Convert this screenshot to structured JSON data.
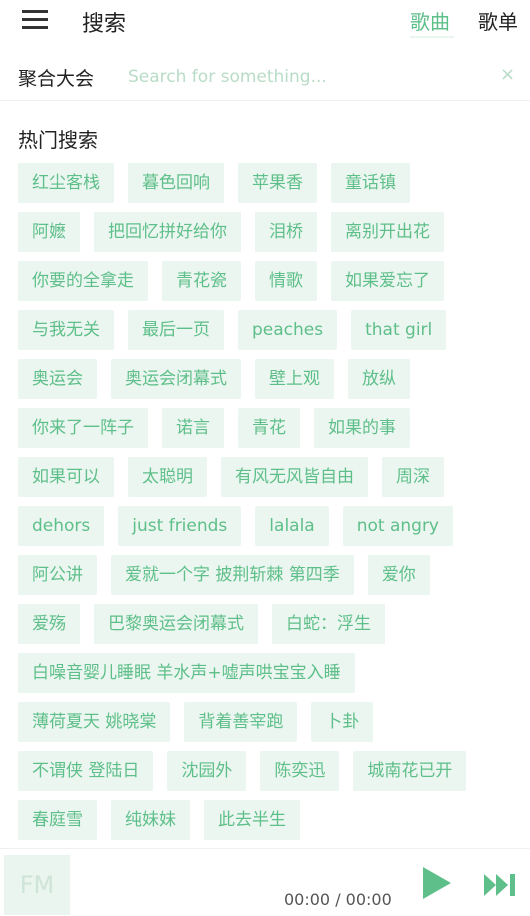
{
  "header": {
    "title": "搜索",
    "tabs": [
      "歌曲",
      "歌单"
    ]
  },
  "search": {
    "scope": "聚合大会",
    "placeholder": "Search for something...",
    "clear": "×"
  },
  "hot": {
    "title": "热门搜索",
    "rows": [
      [
        "红尘客栈",
        "暮色回响",
        "苹果香",
        "童话镇"
      ],
      [
        "阿嬷",
        "把回忆拼好给你",
        "泪桥",
        "离别开出花"
      ],
      [
        "你要的全拿走",
        "青花瓷",
        "情歌",
        "如果爱忘了"
      ],
      [
        "与我无关",
        "最后一页",
        "peaches",
        "that girl"
      ],
      [
        "奥运会",
        "奥运会闭幕式",
        "壁上观",
        "放纵"
      ],
      [
        "你来了一阵子",
        "诺言",
        "青花",
        "如果的事"
      ],
      [
        "如果可以",
        "太聪明",
        "有风无风皆自由",
        "周深"
      ],
      [
        "dehors",
        "just friends",
        "lalala",
        "not angry"
      ],
      [
        "阿公讲",
        "爱就一个字 披荆斩棘 第四季",
        "爱你"
      ],
      [
        "爱殇",
        "巴黎奥运会闭幕式",
        "白蛇：浮生"
      ],
      [
        "白噪音婴儿睡眠 羊水声+嘘声哄宝宝入睡"
      ],
      [
        "薄荷夏天 姚晓棠",
        "背着善宰跑",
        "卜卦"
      ],
      [
        "不谓侠 登陆日",
        "沈园外",
        "陈奕迅",
        "城南花已开"
      ],
      [
        "春庭雪",
        "纯妹妹",
        "此去半生"
      ]
    ]
  },
  "player": {
    "fm": "FM",
    "time": "00:00 / 00:00"
  },
  "colors": {
    "accent": "#5fbf8a",
    "tag_bg": "#eaf6ef"
  }
}
